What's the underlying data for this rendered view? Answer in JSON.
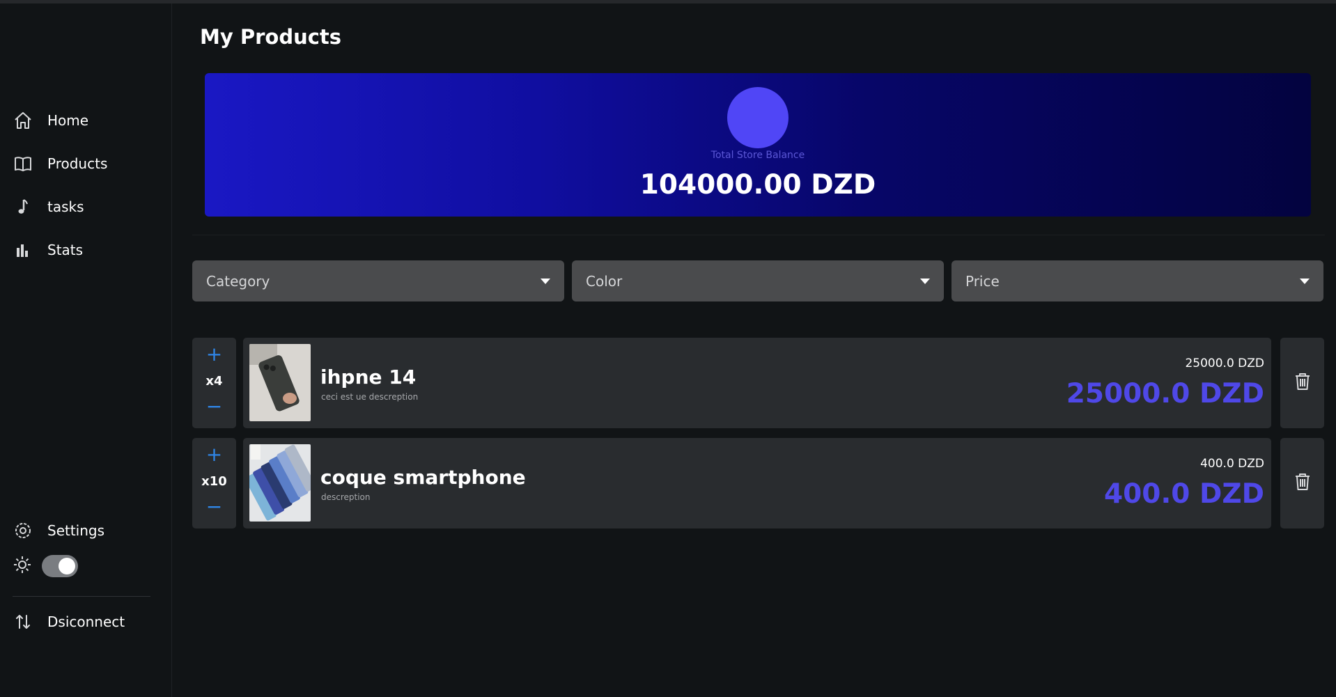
{
  "sidebar": {
    "items": [
      {
        "label": "Home",
        "icon": "home-icon"
      },
      {
        "label": "Products",
        "icon": "book-icon"
      },
      {
        "label": "tasks",
        "icon": "music-note-icon"
      },
      {
        "label": "Stats",
        "icon": "bar-chart-icon"
      }
    ],
    "settings_label": "Settings",
    "theme_toggle_on": true,
    "disconnect_label": "Dsiconnect"
  },
  "main": {
    "title": "My Products",
    "balance": {
      "caption": "Total Store Balance",
      "amount": "104000.00 DZD",
      "avatar_color": "#5046f6"
    },
    "filters": [
      {
        "label": "Category"
      },
      {
        "label": "Color"
      },
      {
        "label": "Price"
      }
    ],
    "products": [
      {
        "quantity": "x4",
        "name": "ihpne 14",
        "description": "ceci est ue descreption",
        "price_small": "25000.0 DZD",
        "price_big": "25000.0 DZD"
      },
      {
        "quantity": "x10",
        "name": "coque smartphone",
        "description": "descreption",
        "price_small": "400.0 DZD",
        "price_big": "400.0 DZD"
      }
    ]
  },
  "colors": {
    "accent": "#4f48e8",
    "quantity_controls": "#2f86e8",
    "card_background": "#292c2f",
    "page_background": "#111416"
  }
}
